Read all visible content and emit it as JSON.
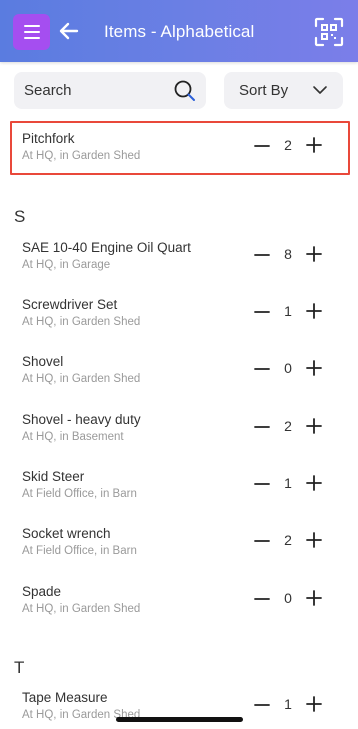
{
  "header": {
    "title": "Items - Alphabetical",
    "menu_icon": "hamburger-icon",
    "back_icon": "arrow-left-icon",
    "scan_icon": "qr-scan-icon",
    "accent_color": "#a54ef0"
  },
  "search": {
    "placeholder": "Search",
    "icon": "search-icon"
  },
  "sort": {
    "label": "Sort By",
    "icon": "chevron-down-icon"
  },
  "pinned_item": {
    "name": "Pitchfork",
    "location": "At HQ, in Garden Shed",
    "quantity": "2",
    "highlight_color": "#e9483a"
  },
  "sections": [
    {
      "letter": "S",
      "items": [
        {
          "name": "SAE 10-40 Engine Oil Quart",
          "location": "At HQ, in Garage",
          "quantity": "8"
        },
        {
          "name": "Screwdriver Set",
          "location": "At HQ, in Garden Shed",
          "quantity": "1"
        },
        {
          "name": "Shovel",
          "location": "At HQ, in Garden Shed",
          "quantity": "0"
        },
        {
          "name": "Shovel - heavy duty",
          "location": "At HQ, in Basement",
          "quantity": "2"
        },
        {
          "name": "Skid Steer",
          "location": "At Field Office, in Barn",
          "quantity": "1"
        },
        {
          "name": "Socket wrench",
          "location": "At Field Office, in Barn",
          "quantity": "2"
        },
        {
          "name": "Spade",
          "location": "At HQ, in Garden Shed",
          "quantity": "0"
        }
      ]
    },
    {
      "letter": "T",
      "items": [
        {
          "name": "Tape Measure",
          "location": "At HQ, in Garden Shed",
          "quantity": "1"
        }
      ]
    }
  ]
}
